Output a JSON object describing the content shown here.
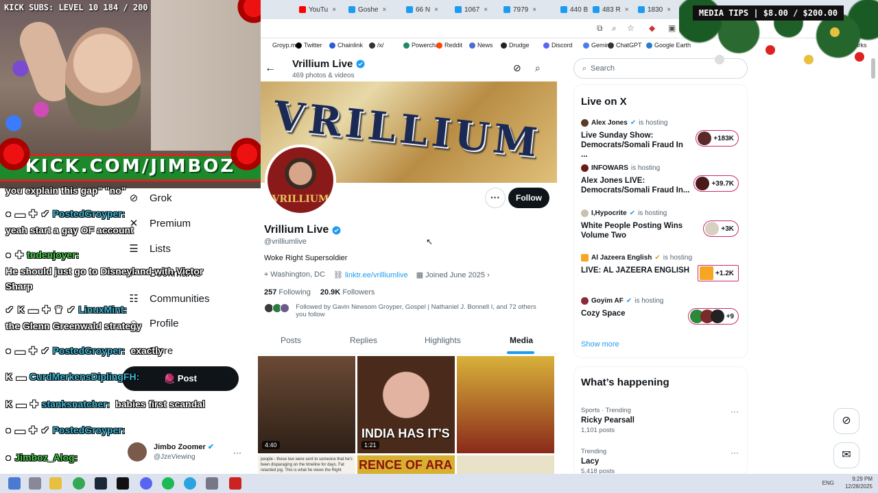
{
  "browser": {
    "tabs": [
      {
        "label": "YouTu",
        "color": "#ff0000"
      },
      {
        "label": "Goshe",
        "color": "#1d9bf0"
      },
      {
        "label": "66 N",
        "color": "#1d9bf0"
      },
      {
        "label": "1067",
        "color": "#1d9bf0"
      },
      {
        "label": "7979",
        "color": "#1d9bf0"
      },
      {
        "label": "440 B",
        "color": "#1d9bf0"
      },
      {
        "label": "483 R",
        "color": "#1d9bf0"
      },
      {
        "label": "1830",
        "color": "#1d9bf0"
      }
    ],
    "bookmarks": [
      {
        "label": "Groyp.me",
        "color": "#ffffff"
      },
      {
        "label": "Twitter",
        "color": "#000000"
      },
      {
        "label": "Chainlink",
        "color": "#2a5ada"
      },
      {
        "label": "/x/",
        "color": "#333333"
      },
      {
        "label": "Powerchat",
        "color": "#1c8a6a"
      },
      {
        "label": "Reddit",
        "color": "#ff4500"
      },
      {
        "label": "News",
        "color": "#4a6cd4"
      },
      {
        "label": "Drudge",
        "color": "#222222"
      },
      {
        "label": "Discord",
        "color": "#5865f2"
      },
      {
        "label": "Gemini",
        "color": "#4a7cf0"
      },
      {
        "label": "ChatGPT",
        "color": "#333333"
      },
      {
        "label": "Google Earth",
        "color": "#2a7ad4"
      }
    ],
    "all_bookmarks": "All Bookmarks"
  },
  "overlay": {
    "kick_subs": "KICK SUBS: LEVEL 10 184 / 200",
    "kick_url": "KICK.COM/JIMBOZ",
    "media_tips": "MEDIA TIPS | $8.00 / $200.00"
  },
  "chat": [
    {
      "badges": "",
      "user": "",
      "text": "you explain this gap\" \"no\""
    },
    {
      "badges": "● ▬ ✚ ✔",
      "user": "PostedGroyper:",
      "text": ""
    },
    {
      "badges": "",
      "user": "",
      "text": "yeah start a gay OF account"
    },
    {
      "badges": "● ✚",
      "user": "tndenjoyer:",
      "text": ""
    },
    {
      "badges": "",
      "user": "",
      "text": "He should just go to Disneyland with Victor"
    },
    {
      "badges": "",
      "user": "",
      "text": "Sharp"
    },
    {
      "badges": "✔ K ▬ ✚ ♛ ✔",
      "user": "LinuxMint:",
      "text": ""
    },
    {
      "badges": "",
      "user": "",
      "text": "the Glenn Greenwald strategy"
    },
    {
      "badges": "● ▬ ✚ ✔",
      "user": "PostedGroyper:",
      "text": "exactly"
    },
    {
      "badges": "K ▬",
      "user": "CurdMerkensDiplingFH:",
      "text": ""
    },
    {
      "badges": "K ▬ ✚",
      "user": "stanksnatcher:",
      "text": "babies first scandal"
    },
    {
      "badges": "● ▬ ✚ ✔",
      "user": "PostedGroyper:",
      "text": ""
    },
    {
      "badges": "●",
      "user": "Jimboz_Alog:",
      "text": ""
    }
  ],
  "xnav": {
    "items": [
      {
        "label": "Grok",
        "icon": "grok-icon"
      },
      {
        "label": "Premium",
        "icon": "x-icon"
      },
      {
        "label": "Lists",
        "icon": "list-icon"
      },
      {
        "label": "Bookmarks",
        "icon": "bookmark-icon"
      },
      {
        "label": "Communities",
        "icon": "communities-icon"
      },
      {
        "label": "Profile",
        "icon": "profile-icon"
      },
      {
        "label": "More",
        "icon": "more-icon"
      }
    ],
    "post_label": "Post",
    "account_name": "Jimbo Zoomer",
    "account_handle": "@JzeViewing"
  },
  "profile": {
    "top_name": "Vrillium Live",
    "top_count": "469 photos & videos",
    "banner_text": "VRILLIUM",
    "avatar_text": "VRILLIUM",
    "follow_label": "Follow",
    "name": "Vrillium Live",
    "handle": "@vrilliumlive",
    "bio": "Woke Right Supersoldier",
    "location": "Washington, DC",
    "link": "linktr.ee/vrilliumlive",
    "joined": "Joined June 2025",
    "following_count": "257",
    "following_label": "Following",
    "followers_count": "20.9K",
    "followers_label": "Followers",
    "followed_by": "Followed by Gavin Newsom Groyper, Gospel | Nathaniel J. Bonnell I, and 72 others you follow",
    "tabs": [
      "Posts",
      "Replies",
      "Highlights",
      "Media"
    ],
    "active_tab": "Media",
    "media": [
      {
        "duration": "4:40",
        "caption": ""
      },
      {
        "duration": "1:21",
        "caption": "INDIA HAS IT'S"
      },
      {
        "duration": "",
        "caption": ""
      },
      {
        "duration": "",
        "caption": ""
      },
      {
        "duration": "",
        "caption": "RENCE OF ARA"
      },
      {
        "duration": "",
        "caption": ""
      }
    ],
    "media4_text": "people - these two were sent to someone that he's been disparaging on the timeline for days. Fat retarded pig. This is what he views the Right"
  },
  "sidebar": {
    "search_placeholder": "Search",
    "live_title": "Live on X",
    "live": [
      {
        "host": "Alex Jones",
        "status": "is hosting",
        "title": "Live Sunday Show: Democrats/Somali Fraud In ...",
        "count": "+183K"
      },
      {
        "host": "INFOWARS",
        "status": "is hosting",
        "title": "Alex Jones LIVE: Democrats/Somali Fraud In...",
        "count": "+39.7K"
      },
      {
        "host": "I,Hypocrite",
        "status": "is hosting",
        "title": "White People Posting Wins Volume Two",
        "count": "+3K"
      },
      {
        "host": "Al Jazeera English",
        "status": "is hosting",
        "title": "LIVE: AL JAZEERA ENGLISH",
        "count": "+1.2K"
      },
      {
        "host": "Goyim AF",
        "status": "is hosting",
        "title": "Cozy Space",
        "count": "+9"
      }
    ],
    "show_more": "Show more",
    "happening_title": "What’s happening",
    "trends": [
      {
        "category": "Sports · Trending",
        "name": "Ricky Pearsall",
        "posts": "1,101 posts"
      },
      {
        "category": "Trending",
        "name": "Lacy",
        "posts": "5,418 posts"
      }
    ]
  },
  "taskbar": {
    "lang": "ENG",
    "time": "9:29 PM",
    "date": "12/28/2025"
  }
}
